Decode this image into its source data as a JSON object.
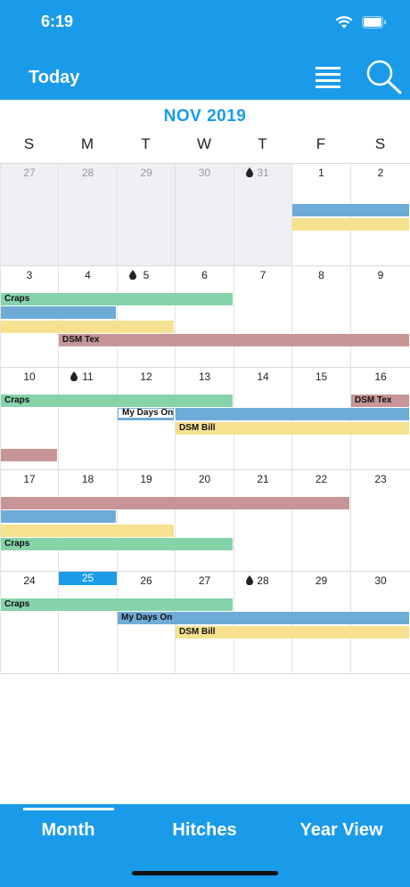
{
  "status": {
    "time": "6:19"
  },
  "header": {
    "today_label": "Today"
  },
  "calendar": {
    "month_title": "NOV 2019",
    "weekdays": [
      "S",
      "M",
      "T",
      "W",
      "T",
      "F",
      "S"
    ],
    "weeks": [
      [
        {
          "d": "27",
          "out": true
        },
        {
          "d": "28",
          "out": true
        },
        {
          "d": "29",
          "out": true
        },
        {
          "d": "30",
          "out": true
        },
        {
          "d": "31",
          "out": true,
          "drop": true
        },
        {
          "d": "1"
        },
        {
          "d": "2"
        }
      ],
      [
        {
          "d": "3"
        },
        {
          "d": "4"
        },
        {
          "d": "5",
          "drop": true
        },
        {
          "d": "6"
        },
        {
          "d": "7"
        },
        {
          "d": "8"
        },
        {
          "d": "9"
        }
      ],
      [
        {
          "d": "10"
        },
        {
          "d": "11",
          "drop": true
        },
        {
          "d": "12"
        },
        {
          "d": "13"
        },
        {
          "d": "14"
        },
        {
          "d": "15"
        },
        {
          "d": "16"
        }
      ],
      [
        {
          "d": "17"
        },
        {
          "d": "18"
        },
        {
          "d": "19"
        },
        {
          "d": "20"
        },
        {
          "d": "21"
        },
        {
          "d": "22"
        },
        {
          "d": "23"
        }
      ],
      [
        {
          "d": "24"
        },
        {
          "d": "25",
          "today": true
        },
        {
          "d": "26"
        },
        {
          "d": "27"
        },
        {
          "d": "28",
          "drop": true
        },
        {
          "d": "29"
        },
        {
          "d": "30"
        }
      ]
    ],
    "events": [
      {
        "week": 0,
        "start": 5,
        "end": 6,
        "lane": 1,
        "type": "blue",
        "label": ""
      },
      {
        "week": 0,
        "start": 5,
        "end": 6,
        "lane": 2,
        "type": "yellow",
        "label": ""
      },
      {
        "week": 1,
        "start": 0,
        "end": 3,
        "lane": 0,
        "type": "craps",
        "label": "Craps"
      },
      {
        "week": 1,
        "start": 0,
        "end": 1,
        "lane": 1,
        "type": "blue",
        "label": ""
      },
      {
        "week": 1,
        "start": 0,
        "end": 2,
        "lane": 2,
        "type": "yellow",
        "label": ""
      },
      {
        "week": 1,
        "start": 1,
        "end": 6,
        "lane": 3,
        "type": "rose",
        "label": "DSM Tex"
      },
      {
        "week": 2,
        "start": 0,
        "end": 3,
        "lane": 0,
        "type": "craps",
        "label": "Craps"
      },
      {
        "week": 2,
        "start": 2,
        "end": 2,
        "lane": 1,
        "type": "daysOnLabel",
        "label": "My Days On"
      },
      {
        "week": 2,
        "start": 3,
        "end": 6,
        "lane": 1,
        "type": "blue",
        "label": ""
      },
      {
        "week": 2,
        "start": 3,
        "end": 6,
        "lane": 2,
        "type": "yellow",
        "label": "DSM Bill"
      },
      {
        "week": 2,
        "start": 6,
        "end": 6,
        "lane": 0,
        "type": "rose",
        "label": "DSM Tex"
      },
      {
        "week": 2,
        "start": 0,
        "end": 0,
        "lane": 4,
        "type": "rose",
        "label": ""
      },
      {
        "week": 3,
        "start": 0,
        "end": 5,
        "lane": 0,
        "type": "rose",
        "label": ""
      },
      {
        "week": 3,
        "start": 0,
        "end": 1,
        "lane": 1,
        "type": "blue",
        "label": ""
      },
      {
        "week": 3,
        "start": 0,
        "end": 2,
        "lane": 2,
        "type": "yellow",
        "label": ""
      },
      {
        "week": 3,
        "start": 0,
        "end": 3,
        "lane": 3,
        "type": "craps",
        "label": "Craps"
      },
      {
        "week": 4,
        "start": 0,
        "end": 3,
        "lane": 0,
        "type": "craps",
        "label": "Craps"
      },
      {
        "week": 4,
        "start": 2,
        "end": 6,
        "lane": 1,
        "type": "daysOn",
        "label": "My Days On"
      },
      {
        "week": 4,
        "start": 3,
        "end": 6,
        "lane": 2,
        "type": "yellow",
        "label": "DSM Bill"
      }
    ]
  },
  "tabs": [
    {
      "label": "Month",
      "active": true
    },
    {
      "label": "Hitches",
      "active": false
    },
    {
      "label": "Year View",
      "active": false
    }
  ],
  "colors": {
    "accent": "#1a9bea",
    "craps": "#86d3a9",
    "days_on": "#6fabd7",
    "dsm_bill": "#f5e18f",
    "dsm_tex": "#c79596"
  },
  "icons": [
    "wifi-icon",
    "battery-icon",
    "cellular-icon",
    "menu-icon",
    "search-icon",
    "drop-icon"
  ]
}
